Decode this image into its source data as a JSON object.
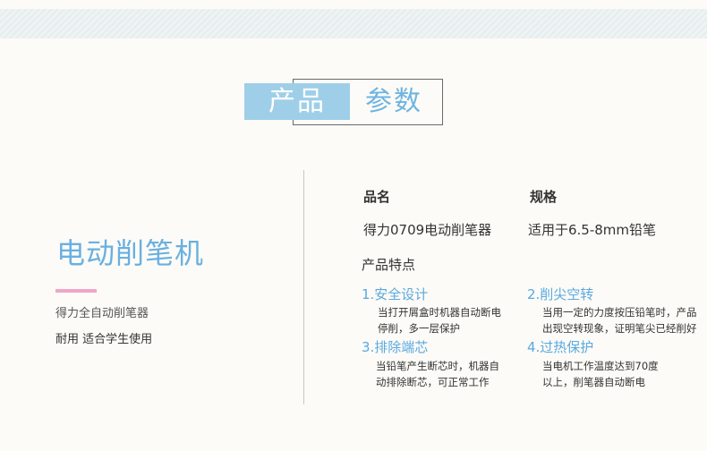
{
  "header": {
    "title_left": "产品",
    "title_right": "参数"
  },
  "product": {
    "name": "电动削笔机",
    "subtitle": "得力全自动削笔器",
    "tagline": "耐用 适合学生使用"
  },
  "specs": {
    "name_label": "品名",
    "name_value": "得力0709电动削笔器",
    "spec_label": "规格",
    "spec_value": "适用于6.5-8mm铅笔",
    "features_label": "产品特点"
  },
  "features": [
    {
      "title": "1.安全设计",
      "line1": "当打开屑盒时机器自动断电",
      "line2": "停削，多一层保护"
    },
    {
      "title": "2.削尖空转",
      "line1": "当用一定的力度按压铅笔时，产品",
      "line2": "出现空转现象，证明笔尖已经削好"
    },
    {
      "title": "3.排除端芯",
      "line1": "当铅笔产生断芯时，机器自",
      "line2": "动排除断芯，可正常工作"
    },
    {
      "title": "4.过热保护",
      "line1": "当电机工作温度达到70度",
      "line2": "以上，削笔器自动断电"
    }
  ],
  "colors": {
    "accent_blue": "#6ab0e0",
    "title_block": "#9fcfe8",
    "pink_rule": "#f0a6c6"
  }
}
